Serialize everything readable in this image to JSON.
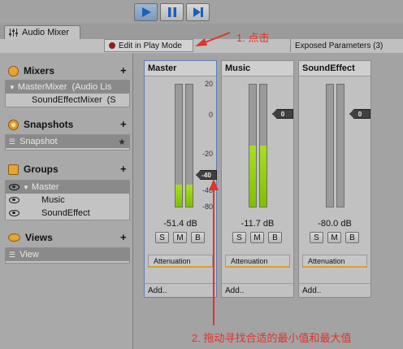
{
  "toolbar_top": {
    "play_icon": "play-icon",
    "pause_icon": "pause-icon",
    "step_icon": "step-icon"
  },
  "window": {
    "tab_label": "Audio Mixer",
    "edit_play_mode": "Edit in Play Mode",
    "exposed_parameters": "Exposed Parameters (3)"
  },
  "sidebar": {
    "mixers": {
      "title": "Mixers",
      "plus": "+",
      "items": [
        {
          "label": "MasterMixer",
          "suffix": "(Audio Lis"
        },
        {
          "label": "SoundEffectMixer",
          "suffix": "(S"
        }
      ]
    },
    "snapshots": {
      "title": "Snapshots",
      "plus": "+",
      "items": [
        {
          "label": "Snapshot"
        }
      ]
    },
    "groups": {
      "title": "Groups",
      "plus": "+",
      "items": [
        {
          "label": "Master"
        },
        {
          "label": "Music"
        },
        {
          "label": "SoundEffect"
        }
      ]
    },
    "views": {
      "title": "Views",
      "plus": "+",
      "items": [
        {
          "label": "View"
        }
      ]
    }
  },
  "strips": [
    {
      "name": "Master",
      "db": "-51.4 dB",
      "attenuation": "Attenuation",
      "add": "Add..",
      "level": 0.18,
      "thumb": "-40"
    },
    {
      "name": "Music",
      "db": "-11.7 dB",
      "attenuation": "Attenuation",
      "add": "Add..",
      "level": 0.5,
      "thumb": "0"
    },
    {
      "name": "SoundEffect",
      "db": "-80.0 dB",
      "attenuation": "Attenuation",
      "add": "Add..",
      "level": 0,
      "thumb": "0"
    }
  ],
  "smb": {
    "s": "S",
    "m": "M",
    "b": "B"
  },
  "scale": [
    "20",
    "0",
    "-20",
    "-40",
    "-80"
  ],
  "annotations": {
    "step1": "1. 点击",
    "step2": "2. 拖动寻找合适的最小值和最大值"
  }
}
